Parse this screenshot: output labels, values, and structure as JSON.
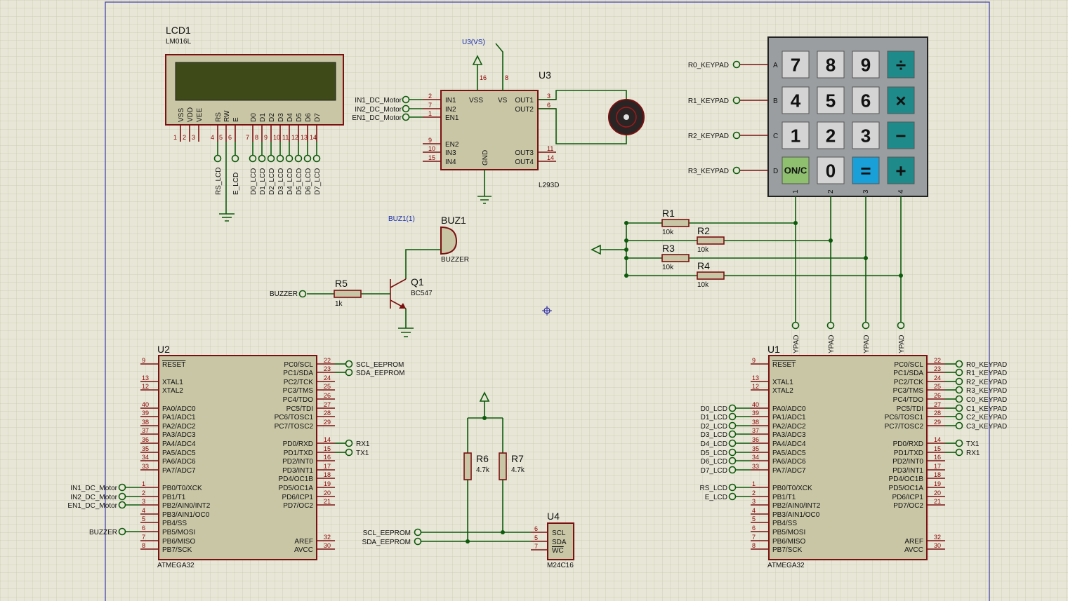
{
  "lcd": {
    "ref": "LCD1",
    "part": "LM016L",
    "pins": [
      [
        "VSS",
        "1"
      ],
      [
        "VDD",
        "2"
      ],
      [
        "VEE",
        "3"
      ],
      [
        "RS",
        "4"
      ],
      [
        "RW",
        "5"
      ],
      [
        "E",
        "6"
      ],
      [
        "D0",
        "7"
      ],
      [
        "D1",
        "8"
      ],
      [
        "D2",
        "9"
      ],
      [
        "D3",
        "10"
      ],
      [
        "D4",
        "11"
      ],
      [
        "D5",
        "12"
      ],
      [
        "D6",
        "13"
      ],
      [
        "D7",
        "14"
      ]
    ],
    "nets": [
      "RS_LCD",
      "E_LCD",
      "D0_LCD",
      "D1_LCD",
      "D2_LCD",
      "D3_LCD",
      "D4_LCD",
      "D5_LCD",
      "D6_LCD",
      "D7_LCD"
    ]
  },
  "driver": {
    "ref": "U3",
    "part": "L293D",
    "vs_label": "U3(VS)",
    "left_pins": [
      [
        "IN1",
        "2"
      ],
      [
        "IN2",
        "7"
      ],
      [
        "EN1",
        "1"
      ],
      [
        "EN2",
        "9"
      ],
      [
        "IN3",
        "10"
      ],
      [
        "IN4",
        "15"
      ]
    ],
    "right_pins": [
      [
        "OUT1",
        "3"
      ],
      [
        "OUT2",
        "6"
      ],
      [
        "OUT3",
        "11"
      ],
      [
        "OUT4",
        "14"
      ]
    ],
    "top_pins": [
      [
        "VSS",
        "16"
      ],
      [
        "VS",
        "8"
      ]
    ],
    "gnd": "GND",
    "nets": [
      "IN1_DC_Motor",
      "IN2_DC_Motor",
      "EN1_DC_Motor"
    ]
  },
  "buzzer": {
    "ref": "BUZ1",
    "part": "BUZZER",
    "probe": "BUZ1(1)"
  },
  "transistor": {
    "ref": "Q1",
    "part": "BC547"
  },
  "r5": {
    "ref": "R5",
    "value": "1k",
    "net": "BUZZER"
  },
  "keypad": {
    "rows": [
      "A",
      "B",
      "C",
      "D"
    ],
    "cols": [
      "1",
      "2",
      "3",
      "4"
    ],
    "keys": [
      "7",
      "8",
      "9",
      "÷",
      "4",
      "5",
      "6",
      "×",
      "1",
      "2",
      "3",
      "−",
      "ON/C",
      "0",
      "=",
      "+"
    ],
    "row_nets": [
      "R0_KEYPAD",
      "R1_KEYPAD",
      "R2_KEYPAD",
      "R3_KEYPAD"
    ],
    "col_net_suffix": "YPAD"
  },
  "pullups": [
    {
      "ref": "R1",
      "value": "10k"
    },
    {
      "ref": "R2",
      "value": "10k"
    },
    {
      "ref": "R3",
      "value": "10k"
    },
    {
      "ref": "R4",
      "value": "10k"
    }
  ],
  "mcu_pins": {
    "left": [
      [
        "RESET",
        "9"
      ],
      [
        "XTAL1",
        "13"
      ],
      [
        "XTAL2",
        "12"
      ],
      [
        "PA0/ADC0",
        "40"
      ],
      [
        "PA1/ADC1",
        "39"
      ],
      [
        "PA2/ADC2",
        "38"
      ],
      [
        "PA3/ADC3",
        "37"
      ],
      [
        "PA4/ADC4",
        "36"
      ],
      [
        "PA5/ADC5",
        "35"
      ],
      [
        "PA6/ADC6",
        "34"
      ],
      [
        "PA7/ADC7",
        "33"
      ],
      [
        "PB0/T0/XCK",
        "1"
      ],
      [
        "PB1/T1",
        "2"
      ],
      [
        "PB2/AIN0/INT2",
        "3"
      ],
      [
        "PB3/AIN1/OC0",
        "4"
      ],
      [
        "PB4/SS",
        "5"
      ],
      [
        "PB5/MOSI",
        "6"
      ],
      [
        "PB6/MISO",
        "7"
      ],
      [
        "PB7/SCK",
        "8"
      ]
    ],
    "right": [
      [
        "PC0/SCL",
        "22"
      ],
      [
        "PC1/SDA",
        "23"
      ],
      [
        "PC2/TCK",
        "24"
      ],
      [
        "PC3/TMS",
        "25"
      ],
      [
        "PC4/TDO",
        "26"
      ],
      [
        "PC5/TDI",
        "27"
      ],
      [
        "PC6/TOSC1",
        "28"
      ],
      [
        "PC7/TOSC2",
        "29"
      ],
      [
        "PD0/RXD",
        "14"
      ],
      [
        "PD1/TXD",
        "15"
      ],
      [
        "PD2/INT0",
        "16"
      ],
      [
        "PD3/INT1",
        "17"
      ],
      [
        "PD4/OC1B",
        "18"
      ],
      [
        "PD5/OC1A",
        "19"
      ],
      [
        "PD6/ICP1",
        "20"
      ],
      [
        "PD7/OC2",
        "21"
      ],
      [
        "AREF",
        "32"
      ],
      [
        "AVCC",
        "30"
      ]
    ]
  },
  "u2": {
    "ref": "U2",
    "part": "ATMEGA32",
    "left_nets": {
      "PB0/T0/XCK": "IN1_DC_Motor",
      "PB1/T1": "IN2_DC_Motor",
      "PB2/AIN0/INT2": "EN1_DC_Motor",
      "PB5/MOSI": "BUZZER"
    },
    "right_nets": {
      "PC0/SCL": "SCL_EEPROM",
      "PC1/SDA": "SDA_EEPROM",
      "PD0/RXD": "RX1",
      "PD1/TXD": "TX1"
    }
  },
  "u1": {
    "ref": "U1",
    "part": "ATMEGA32",
    "left_nets": {
      "PA0/ADC0": "D0_LCD",
      "PA1/ADC1": "D1_LCD",
      "PA2/ADC2": "D2_LCD",
      "PA3/ADC3": "D3_LCD",
      "PA4/ADC4": "D4_LCD",
      "PA5/ADC5": "D5_LCD",
      "PA6/ADC6": "D6_LCD",
      "PA7/ADC7": "D7_LCD",
      "PB0/T0/XCK": "RS_LCD",
      "PB1/T1": "E_LCD"
    },
    "right_nets": {
      "PC0/SCL": "R0_KEYPAD",
      "PC1/SDA": "R1_KEYPAD",
      "PC2/TCK": "R2_KEYPAD",
      "PC3/TMS": "R3_KEYPAD",
      "PC4/TDO": "C0_KEYPAD",
      "PC5/TDI": "C1_KEYPAD",
      "PC6/TOSC1": "C2_KEYPAD",
      "PC7/TOSC2": "C3_KEYPAD",
      "PD0/RXD": "TX1",
      "PD1/TXD": "RX1"
    }
  },
  "eeprom": {
    "ref": "U4",
    "part": "M24C16",
    "pins": [
      [
        "SCL",
        "6"
      ],
      [
        "SDA",
        "5"
      ],
      [
        "WC",
        "7"
      ]
    ],
    "nets": [
      "SCL_EEPROM",
      "SDA_EEPROM"
    ]
  },
  "i2c_pullups": [
    {
      "ref": "R6",
      "value": "4.7k"
    },
    {
      "ref": "R7",
      "value": "4.7k"
    }
  ],
  "colors": {
    "background": "#e8e6d6",
    "grid": "#cfcdb9",
    "border": "#3a3aa8",
    "component": "#7a1010",
    "wire": "#0c5a0c",
    "keypad_teal": "#1f8a8a",
    "keypad_green": "#8fc070",
    "keypad_blue": "#1aa0d8"
  }
}
